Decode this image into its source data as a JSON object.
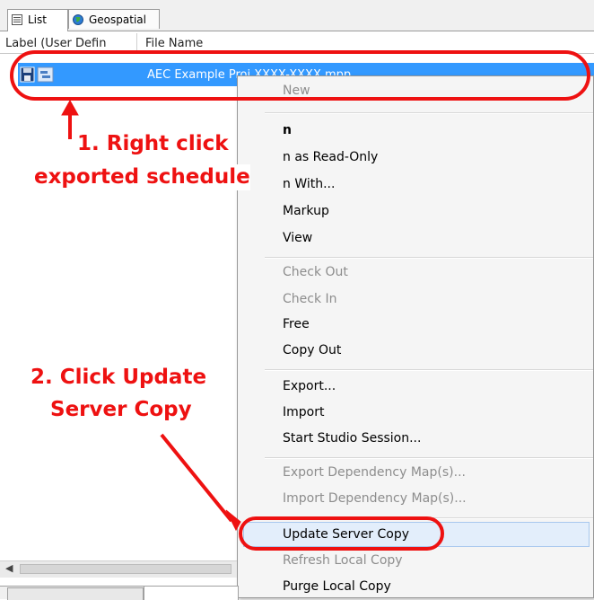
{
  "tabs": [
    {
      "label": "List"
    },
    {
      "label": "Geospatial"
    }
  ],
  "columns": {
    "label": "Label (User Defin",
    "file_name": "File Name"
  },
  "selected_row": {
    "file_name": "AEC Example Proj XXXX-XXXX.mpp"
  },
  "context_menu": {
    "items": [
      {
        "label": "New",
        "enabled": false
      },
      {
        "label": "n",
        "enabled": true,
        "bold": true
      },
      {
        "label": "n as Read-Only",
        "enabled": true
      },
      {
        "label": "n With...",
        "enabled": true
      },
      {
        "label": "Markup",
        "enabled": true
      },
      {
        "label": "View",
        "enabled": true
      },
      {
        "label": "Check Out",
        "enabled": false
      },
      {
        "label": "Check In",
        "enabled": false
      },
      {
        "label": "Free",
        "enabled": true
      },
      {
        "label": "Copy Out",
        "enabled": true
      },
      {
        "label": "Export...",
        "enabled": true
      },
      {
        "label": "Import",
        "enabled": true
      },
      {
        "label": "Start Studio Session...",
        "enabled": true
      },
      {
        "label": "Export Dependency Map(s)...",
        "enabled": false
      },
      {
        "label": "Import Dependency Map(s)...",
        "enabled": false
      },
      {
        "label": "Update Server Copy",
        "enabled": true,
        "highlighted": true
      },
      {
        "label": "Refresh Local Copy",
        "enabled": false
      },
      {
        "label": "Purge Local Copy",
        "enabled": true
      }
    ]
  },
  "annotations": {
    "step1_line1": "1. Right click",
    "step1_line2": "exported schedule",
    "step2_line1": "2. Click Update",
    "step2_line2": "Server Copy",
    "color": "#ee1111"
  },
  "colors": {
    "selection": "#3399ff",
    "menu_background": "#f5f5f5",
    "menu_disabled_text": "#8d8d8d"
  }
}
